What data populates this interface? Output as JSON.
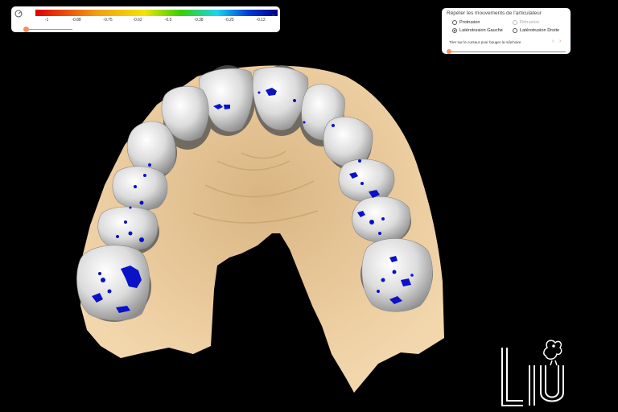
{
  "colorbar": {
    "ticks": [
      "-1",
      "-0.88",
      "-0.75",
      "-0.62",
      "-0.5",
      "-0.38",
      "-0.25",
      "-0.12"
    ],
    "gradient_colors": [
      "#e00000",
      "#f39c12",
      "#f2e400",
      "#35d100",
      "#19d6ef",
      "#003bd6",
      "#00008b"
    ],
    "opacity_value": 0.0
  },
  "articulator": {
    "title": "Répéter les mouvements de l'articulateur",
    "options": {
      "protrusion": "Protrusion",
      "retrusion": "Rétrusion",
      "laterotrusion_gauche": "Latérotrusion Gauche",
      "laterotrusion_droite": "Latérotrusion Droite"
    },
    "selected": "laterotrusion_gauche",
    "hint": "Tirer sur le curseur pour bouger la mâchoire",
    "slider_value": 0.0
  },
  "scene": {
    "gum_color": "#e8c898",
    "tooth_color": "#d9d9d9",
    "contact_color": "#0a12c8"
  },
  "logo": {
    "letters": "LIU",
    "icon": "rooster-logo-icon"
  }
}
